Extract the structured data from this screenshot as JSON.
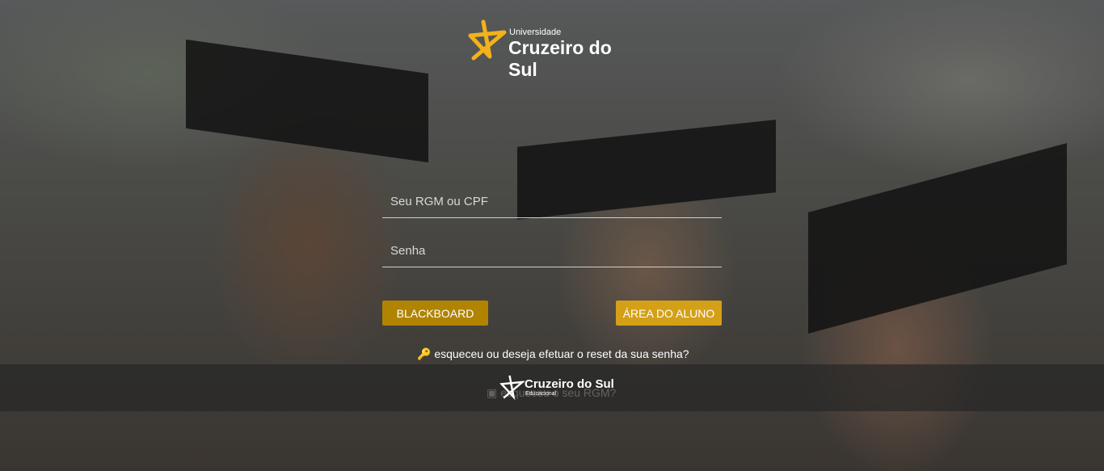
{
  "logo": {
    "small": "Universidade",
    "main": "Cruzeiro do Sul",
    "star_color": "#f2b21b"
  },
  "form": {
    "user_placeholder": "Seu RGM ou CPF",
    "password_placeholder": "Senha"
  },
  "buttons": {
    "blackboard": "BLACKBOARD",
    "area_aluno": "ÁREA DO ALUNO",
    "blackboard_color": "#b08400",
    "area_color": "#d4a017"
  },
  "links": {
    "reset": "esqueceu ou deseja efetuar o reset da sua senha?",
    "rgm": "esqueceu o seu RGM?"
  },
  "footer": {
    "brand": "Cruzeiro do Sul",
    "sub": "Educacional"
  }
}
